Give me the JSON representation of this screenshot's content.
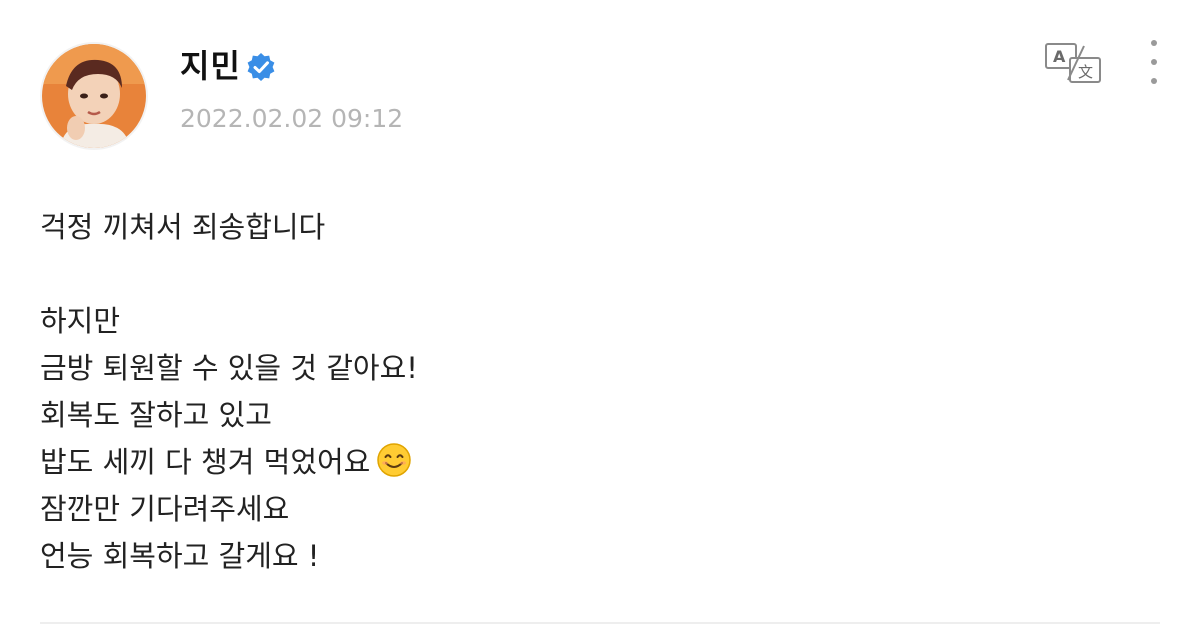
{
  "post": {
    "author": {
      "name": "지민",
      "verified": true,
      "avatar_icon": "profile-photo"
    },
    "timestamp": "2022.02.02 09:12",
    "actions": {
      "translate_icon": "translate-icon",
      "more_icon": "more-vertical-icon"
    },
    "lines": [
      "걱정 끼쳐서 죄송합니다",
      "",
      "하지만",
      "금방 퇴원할 수 있을 것 같아요!",
      "회복도 잘하고 있고",
      "밥도 세끼 다 챙겨 먹었어요",
      "잠깐만 기다려주세요",
      "언능 회복하고 갈게요 !"
    ],
    "emoji": "smiling-face-emoji"
  },
  "colors": {
    "badge": "#3a8ee6",
    "timestamp": "#b5b5b5",
    "avatar_background": "#e8833a"
  }
}
